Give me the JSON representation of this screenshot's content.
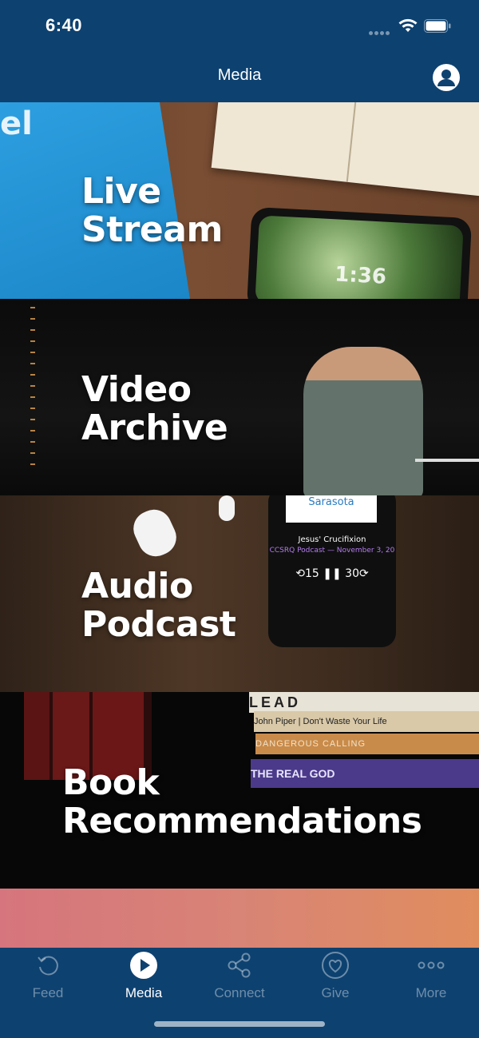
{
  "status_bar": {
    "time": "6:40"
  },
  "nav": {
    "title": "Media"
  },
  "tiles": [
    {
      "id": "live-stream",
      "lines": [
        "Live",
        "Stream"
      ],
      "bg_text": "el",
      "clock": "1:36"
    },
    {
      "id": "video-archive",
      "lines": [
        "Video",
        "Archive"
      ]
    },
    {
      "id": "audio-podcast",
      "lines": [
        "Audio",
        "Podcast"
      ],
      "phone": {
        "card": "Sarasota",
        "track": "Jesus' Crucifixion",
        "subtitle": "CCSRQ Podcast — November 3, 20",
        "controls": "⟲15 ❚❚ 30⟳"
      }
    },
    {
      "id": "book-recommendations",
      "lines": [
        "Book",
        "Recommendations"
      ],
      "books": [
        "LEAD",
        "John Piper | Don't Waste Your Life",
        "DANGEROUS CALLING",
        "THE REAL GOD"
      ]
    },
    {
      "id": "partial-tile"
    }
  ],
  "tabbar": {
    "tabs": [
      {
        "label": "Feed",
        "icon": "refresh-icon",
        "active": false
      },
      {
        "label": "Media",
        "icon": "play-circle-icon",
        "active": true
      },
      {
        "label": "Connect",
        "icon": "share-icon",
        "active": false
      },
      {
        "label": "Give",
        "icon": "heart-circle-icon",
        "active": false
      },
      {
        "label": "More",
        "icon": "more-dots-icon",
        "active": false
      }
    ]
  },
  "colors": {
    "primary": "#0d4170",
    "inactive_tab": "rgba(255,255,255,0.4)",
    "active_tab": "#ffffff"
  }
}
